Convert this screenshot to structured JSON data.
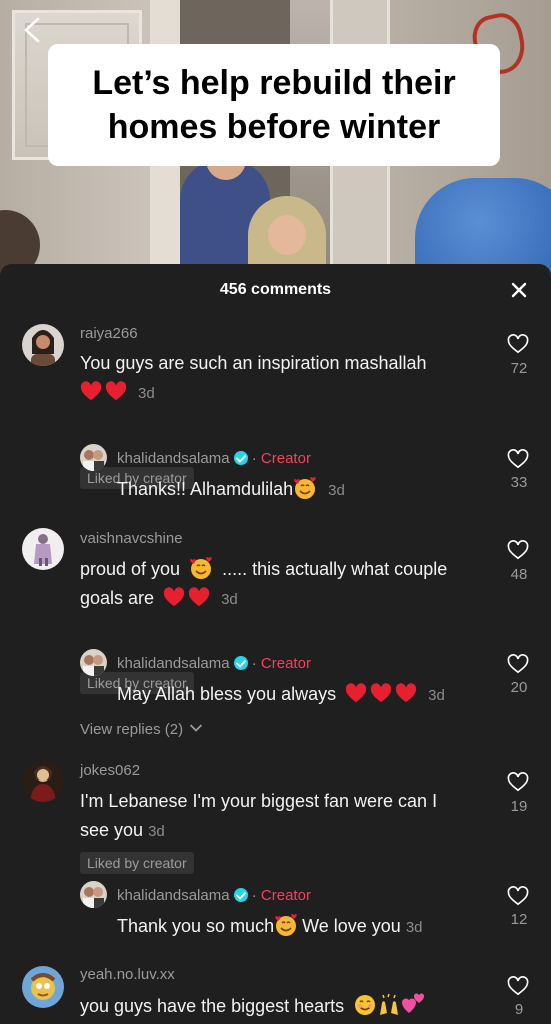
{
  "video": {
    "caption": "Let’s help rebuild their homes before winter"
  },
  "sheet": {
    "comment_count": "456 comments"
  },
  "comments": [
    {
      "username": "raiya266",
      "text": "You guys are such an inspiration mashallah",
      "time": "3d",
      "liked_by_creator": "Liked by creator",
      "likes": "72",
      "reply": {
        "username": "khalidandsalama",
        "creator_label": "Creator",
        "text": "Thanks!! Alhamdulilah",
        "time": "3d",
        "likes": "33"
      }
    },
    {
      "username": "vaishnavcshine",
      "text_part1": "proud of you",
      "text_part2": "..... this actually what couple",
      "text_part3": "goals are",
      "time": "3d",
      "liked_by_creator": "Liked by creator",
      "likes": "48",
      "reply": {
        "username": "khalidandsalama",
        "creator_label": "Creator",
        "text": "May Allah bless you always",
        "time": "3d",
        "likes": "20"
      },
      "view_replies": "View replies (2)"
    },
    {
      "username": "jokes062",
      "text_line1": "I'm Lebanese I'm your biggest fan were can I",
      "text_line2": "see you",
      "time": "3d",
      "liked_by_creator": "Liked by creator",
      "likes": "19",
      "reply": {
        "username": "khalidandsalama",
        "creator_label": "Creator",
        "text_part1": "Thank you so much",
        "text_part2": "We love you",
        "time": "3d",
        "likes": "12"
      }
    },
    {
      "username": "yeah.no.luv.xx",
      "text": "you guys have the biggest hearts",
      "likes": "9"
    }
  ],
  "icons": {
    "back": "chevron-left-icon",
    "close": "close-icon",
    "like": "heart-outline-icon",
    "verified": "verified-badge-icon",
    "heart_emoji": "red-heart-emoji",
    "smile_hearts_emoji": "smiling-face-with-hearts-emoji"
  },
  "colors": {
    "sheet_bg": "#1f1f1f",
    "creator": "#ff3b5c",
    "verified": "#20d5ec",
    "muted_text": "#9a9a9a"
  }
}
